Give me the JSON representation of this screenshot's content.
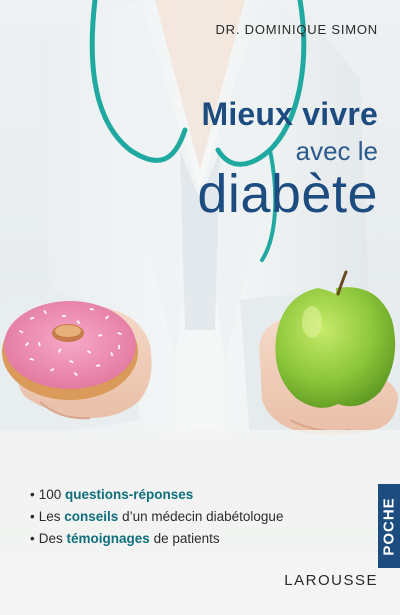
{
  "cover": {
    "author": "DR. DOMINIQUE SIMON",
    "title": {
      "line1": "Mieux vivre",
      "line2": "avec le",
      "line3": "diabète"
    },
    "bullets": [
      {
        "lead": "100",
        "strong": "questions-réponses",
        "rest": ""
      },
      {
        "lead": "Les",
        "strong": "conseils",
        "rest": "d’un médecin diabétologue"
      },
      {
        "lead": "Des",
        "strong": "témoignages",
        "rest": "de patients"
      }
    ],
    "series": "POCHE",
    "publisher": "LAROUSSE",
    "colors": {
      "title_blue": "#1d4c80",
      "highlight_teal": "#0f6f7c",
      "series_tab": "#1d4c80"
    },
    "illustration": {
      "left_hand_item": "pink-donut-icon",
      "right_hand_item": "green-apple-icon",
      "background": "doctor-with-stethoscope"
    }
  }
}
